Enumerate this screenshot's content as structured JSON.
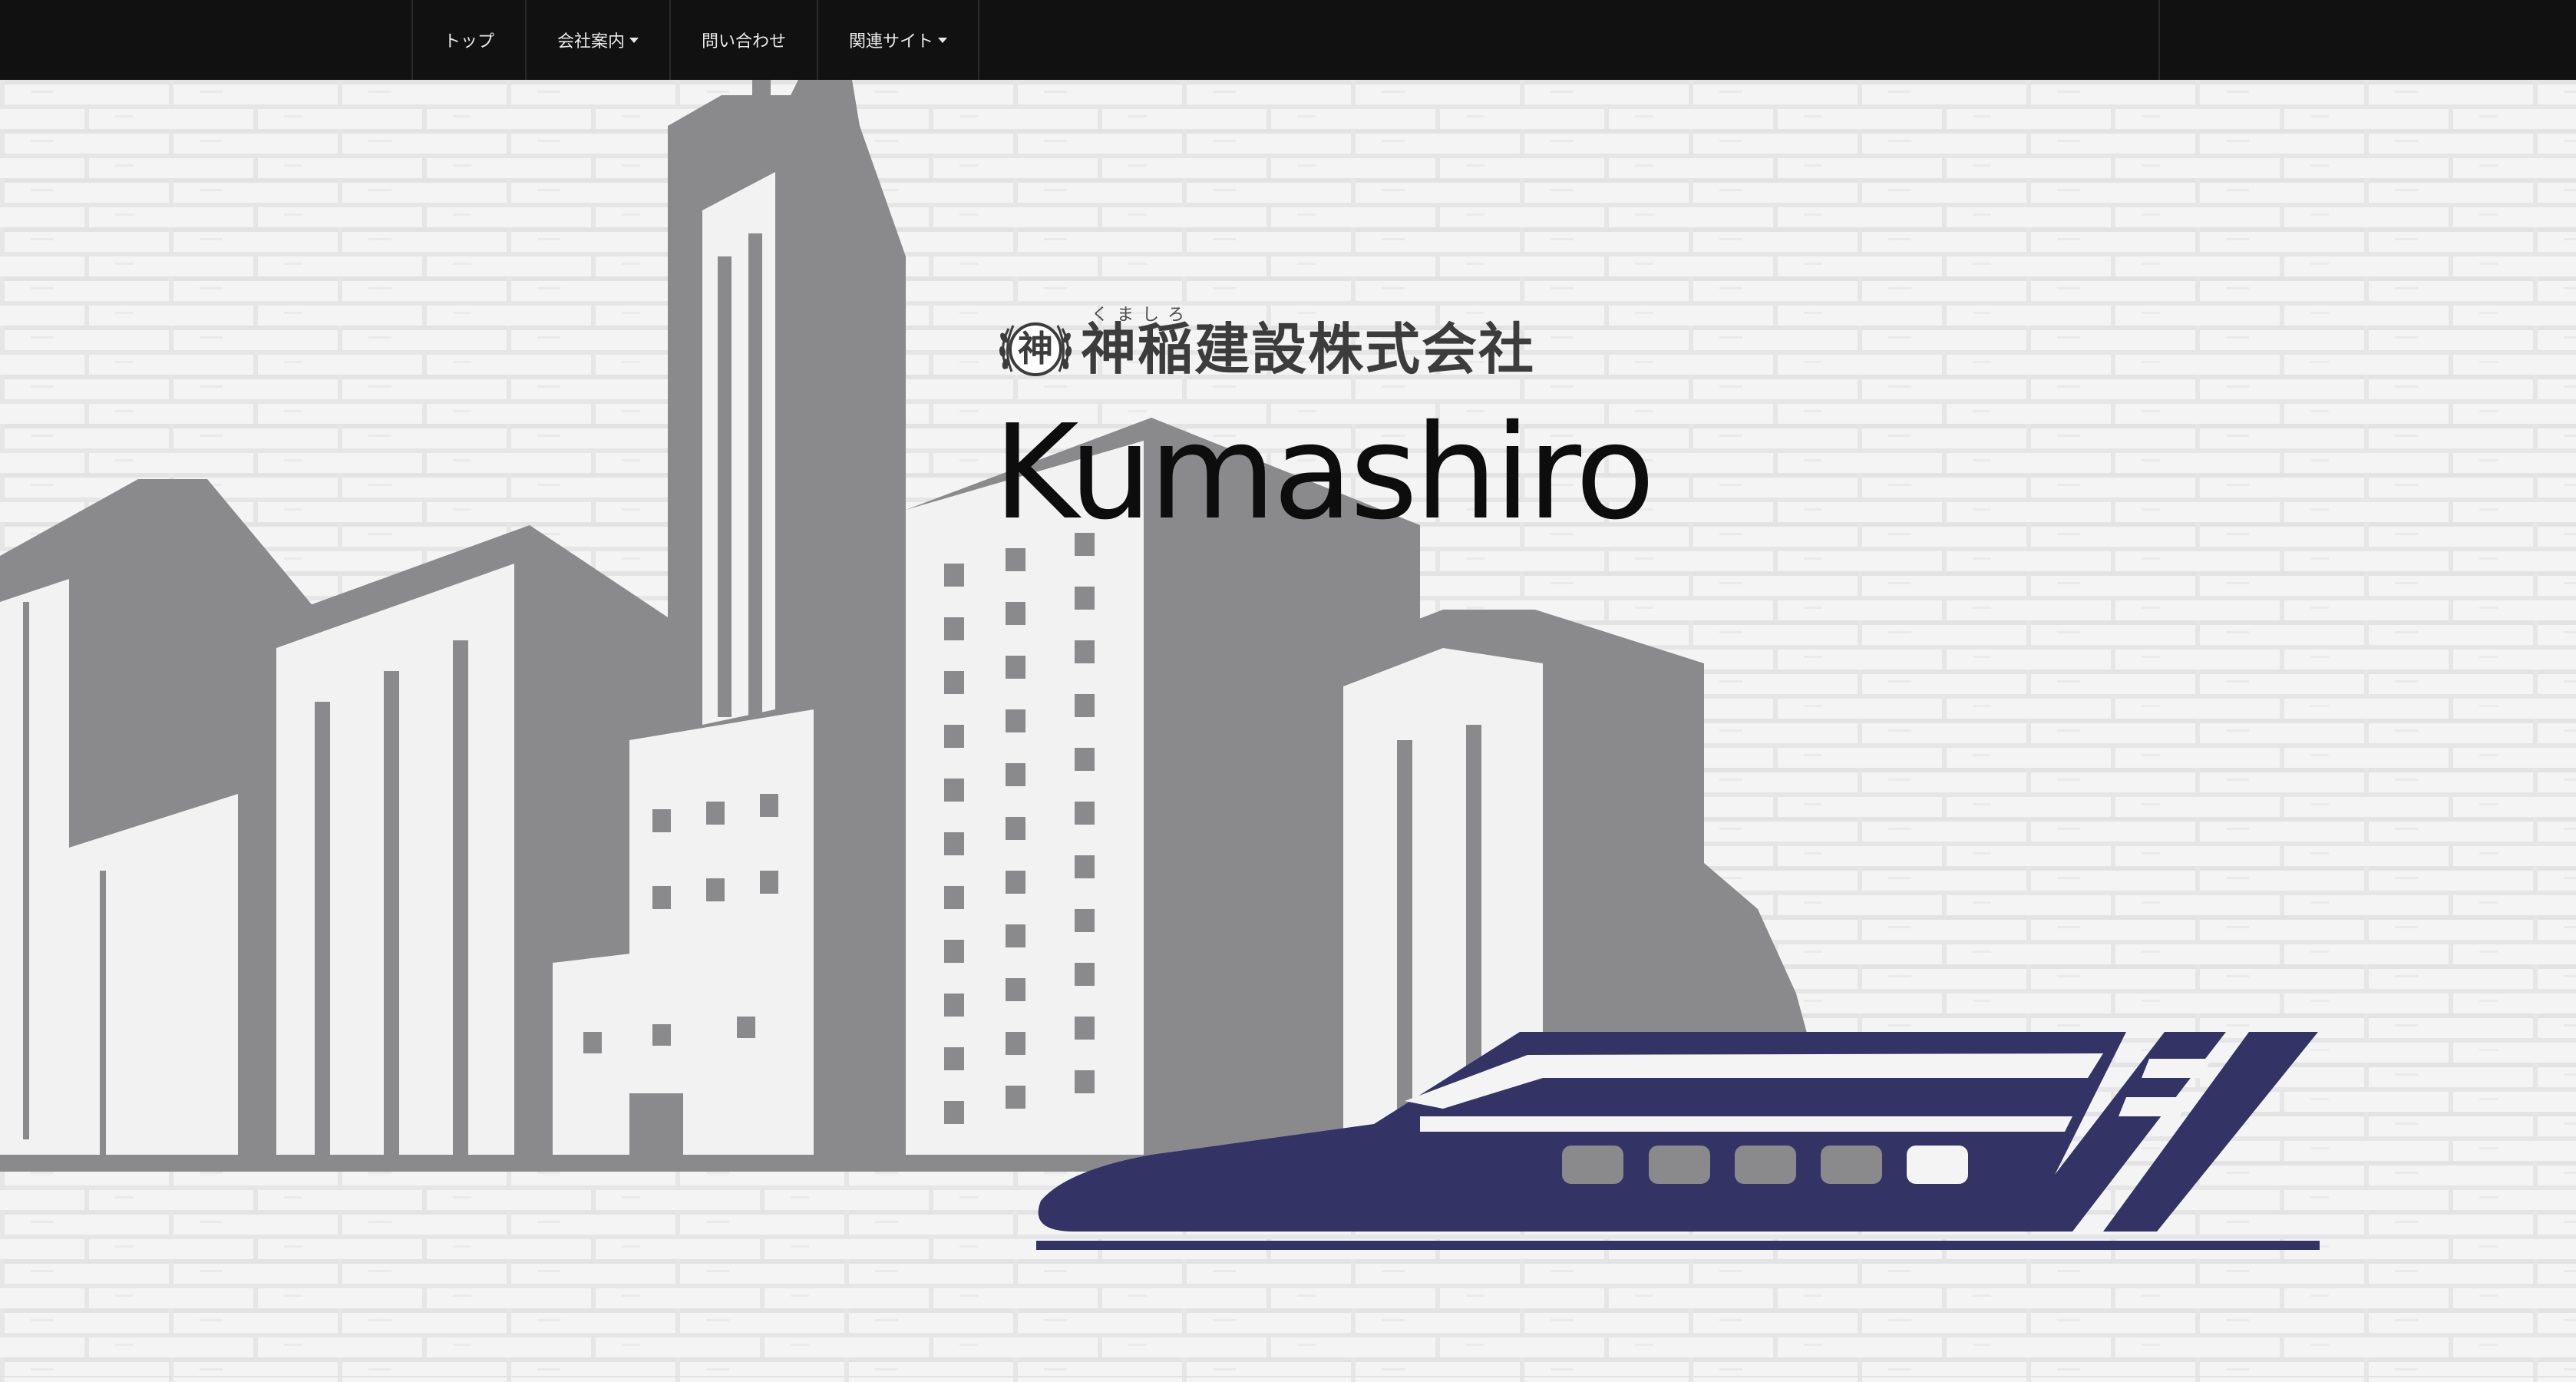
{
  "nav": {
    "items": [
      {
        "label": "トップ",
        "dropdown": false
      },
      {
        "label": "会社案内",
        "dropdown": true
      },
      {
        "label": "問い合わせ",
        "dropdown": false
      },
      {
        "label": "関連サイト",
        "dropdown": true
      }
    ]
  },
  "header": {
    "logo": {
      "emblem_char": "神",
      "ruby": "くましろ",
      "company_name": "神稲建設株式会社"
    },
    "site_title": "Kumashiro"
  },
  "hero": {
    "illustration": "city-buildings-and-bullet-train",
    "colors": {
      "buildings": "#8a8a8c",
      "windows": "#f2f2f2",
      "train": "#333366",
      "brick_wall": "#f1f1f1",
      "navbar": "#111111"
    }
  }
}
